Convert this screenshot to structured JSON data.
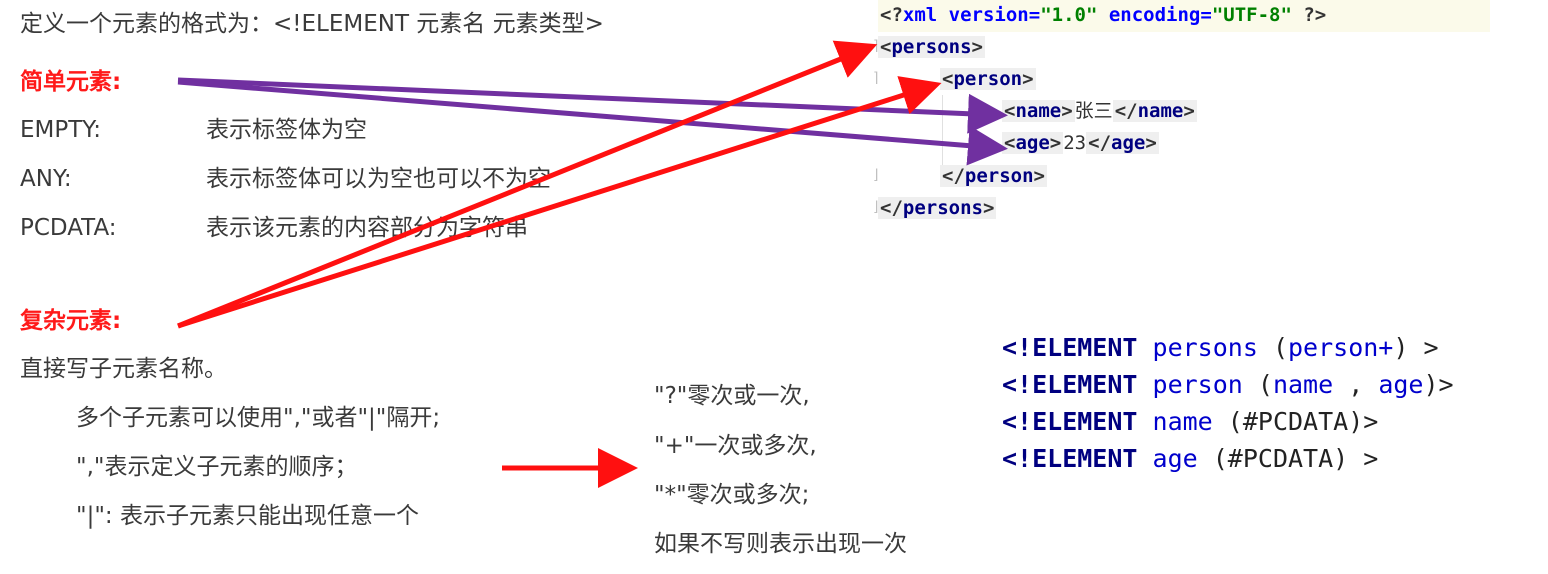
{
  "header": {
    "definition": "定义一个元素的格式为：<!ELEMENT 元素名 元素类型>"
  },
  "simple": {
    "title": "简单元素:",
    "items": [
      {
        "term": "EMPTY:",
        "desc": "表示标签体为空"
      },
      {
        "term": "ANY:",
        "desc": "表示标签体可以为空也可以不为空"
      },
      {
        "term": "PCDATA:",
        "desc": "表示该元素的内容部分为字符串"
      }
    ]
  },
  "complex": {
    "title": "复杂元素:",
    "intro": "直接写子元素名称。",
    "rules": [
      "多个子元素可以使用\",\"或者\"|\"隔开;",
      "\",\"表示定义子元素的顺序；",
      "\"|\": 表示子元素只能出现任意一个"
    ]
  },
  "quantifiers": [
    "\"?\"零次或一次,",
    "\"+\"一次或多次,",
    "\"*\"零次或多次;",
    "如果不写则表示出现一次"
  ],
  "xml": {
    "decl": {
      "open": "<?",
      "name": "xml",
      "a1": "version",
      "v1": "\"1.0\"",
      "a2": "encoding",
      "v2": "\"UTF-8\"",
      "close": "?>"
    },
    "persons": "persons",
    "person": "person",
    "name_tag": "name",
    "name_value": "张三",
    "age_tag": "age",
    "age_value": "23"
  },
  "dtd": [
    {
      "kw": "<!ELEMENT",
      "name": "persons",
      "rest_open": " (",
      "child": "person+",
      "rest_close": ") >"
    },
    {
      "kw": "<!ELEMENT",
      "name": "person",
      "rest_open": " (",
      "child": "name",
      "sep": " , ",
      "child2": "age",
      "rest_close": ")>"
    },
    {
      "kw": "<!ELEMENT",
      "name": "name",
      "rest_open": " (#PCDATA)>"
    },
    {
      "kw": "<!ELEMENT",
      "name": "age",
      "rest_open": " (#PCDATA) >"
    }
  ],
  "colors": {
    "red_arrow": "#ff1010",
    "purple_arrow": "#7030a0",
    "heading_red": "#ff1a1a"
  }
}
